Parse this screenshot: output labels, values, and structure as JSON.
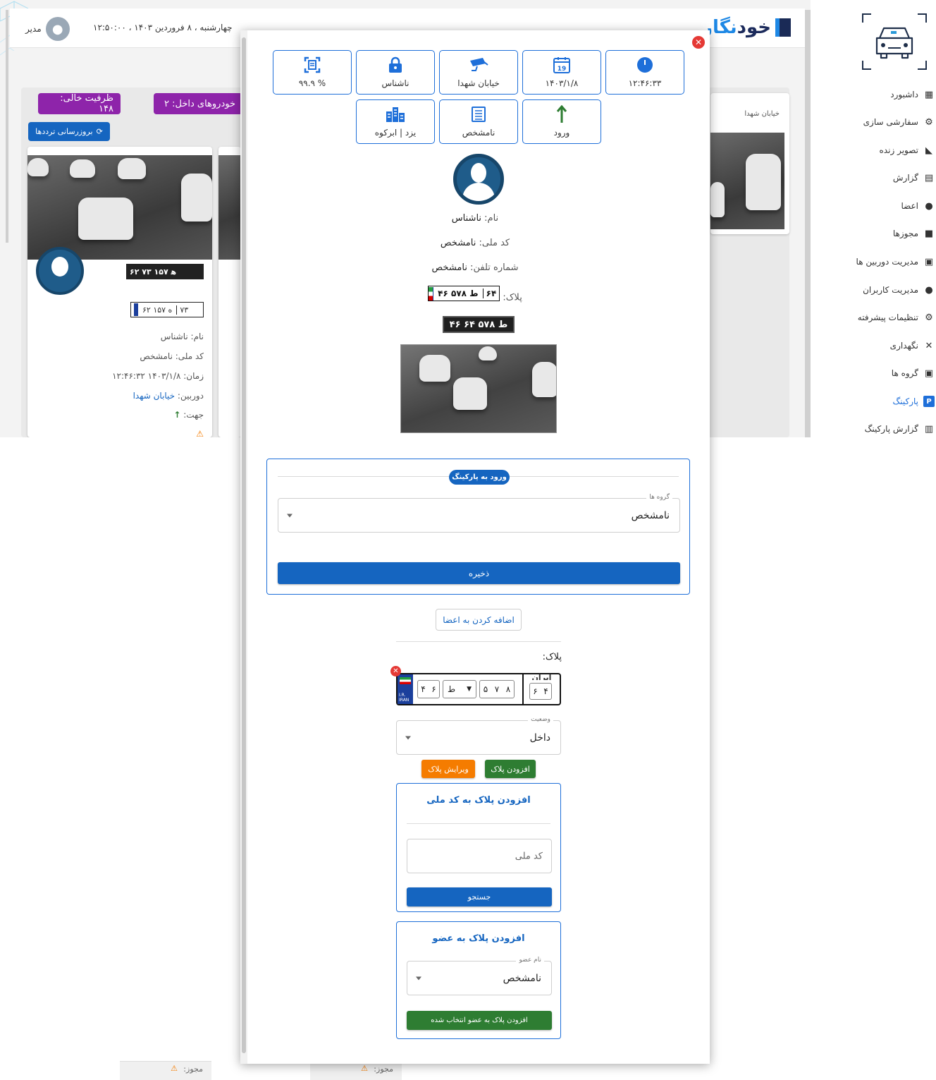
{
  "header": {
    "user_name": "مدیر",
    "datetime": "چهارشنبه ، ۸ فروردین ۱۴۰۳ ، ۱۲:۵۰:۰۰",
    "brand_main": "خود",
    "brand_accent": "نگار"
  },
  "dashboard": {
    "empty_capacity": "ظرفیت خالی:  ۱۴۸",
    "vehicles_inside": "خودروهای داخل:  ۲",
    "refresh_label": "بروزرسانی ترددها",
    "card": {
      "plate_photo": "۶۲ ﻫ ۱۵۷ ۷۳",
      "plate_num": "۶۲ ه ۱۵۷",
      "plate_reg": "۷۳",
      "name": "نام: ناشناس",
      "national_code": "کد ملی: نامشخص",
      "time": "زمان: ۱۴۰۳/۱/۸ ۱۲:۴۶:۳۲",
      "camera_label": "دوربین: ",
      "camera_value": "خیابان شهدا",
      "direction_label": "جهت:",
      "permit_label": "مجوز:"
    },
    "right_card_title": "خیابان شهدا"
  },
  "sidebar": {
    "items": [
      {
        "label": "داشبورد",
        "icon": "dashboard-icon"
      },
      {
        "label": "سفارشی سازی",
        "icon": "gear-icon"
      },
      {
        "label": "تصویر زنده",
        "icon": "camera-icon"
      },
      {
        "label": "گزارش",
        "icon": "report-icon"
      },
      {
        "label": "اعضا",
        "icon": "members-icon"
      },
      {
        "label": "مجوزها",
        "icon": "lock-icon"
      },
      {
        "label": "مدیریت دوربین ها",
        "icon": "camera-manage-icon"
      },
      {
        "label": "مدیریت کاربران",
        "icon": "users-icon"
      },
      {
        "label": "تنظیمات پیشرفته",
        "icon": "advanced-gear-icon"
      },
      {
        "label": "نگهداری",
        "icon": "tools-icon"
      },
      {
        "label": "گروه ها",
        "icon": "groups-icon"
      },
      {
        "label": "پارکینگ",
        "icon": "parking-icon"
      },
      {
        "label": "گزارش پارکینگ",
        "icon": "parking-report-icon"
      }
    ],
    "active": "پارکینگ"
  },
  "modal": {
    "info_row1": [
      {
        "label": "۱۲:۴۶:۳۳",
        "icon": "clock-icon"
      },
      {
        "label": "۱۴۰۳/۱/۸",
        "icon": "calendar-icon",
        "icon_text": "19"
      },
      {
        "label": "خیابان شهدا",
        "icon": "cctv-icon"
      },
      {
        "label": "ناشناس",
        "icon": "lock-icon"
      },
      {
        "label": "% ۹۹.۹",
        "icon": "scan-icon"
      }
    ],
    "info_row2": [
      {
        "label": "ورود",
        "icon": "arrow-up-icon"
      },
      {
        "label": "نامشخص",
        "icon": "list-icon"
      },
      {
        "label": "یزد | ابرکوه",
        "icon": "city-icon"
      }
    ],
    "name_label": "نام:",
    "name_value": "ناشناس",
    "national_label": "کد ملی:",
    "national_value": "نامشخص",
    "phone_label": "شماره تلفن:",
    "phone_value": "نامشخص",
    "plate_label": "پلاک:",
    "plate_num": "۴۶ ط ۵۷۸",
    "plate_reg": "۶۴",
    "plate_photo_text": "۴۶ ط ۵۷۸ ۶۴",
    "parking_entry": {
      "badge": "ورود به پارکینگ",
      "groups_legend": "گروه ها",
      "groups_value": "نامشخص",
      "save_label": "ذخیره"
    },
    "add_member_label": "اضافه کردن به اعضا",
    "plate_editor": {
      "label": "پلاک:",
      "d1": "۴",
      "d2": "۶",
      "letter": "ط",
      "d3": "۵",
      "d4": "۷",
      "d5": "۸",
      "r1": "۶",
      "r2": "۴",
      "iran": "ایران",
      "ir": "I.R.",
      "iran_en": "IRAN"
    },
    "status_legend": "وضعیت",
    "status_value": "داخل",
    "add_plate_label": "افزودن پلاک",
    "edit_plate_label": "ویرایش پلاک",
    "by_national": {
      "title": "افزودن پلاک به کد ملی",
      "placeholder": "کد ملی",
      "search_label": "جستجو"
    },
    "by_member": {
      "title": "افزودن پلاک به عضو",
      "legend": "نام عضو",
      "value": "نامشخص",
      "submit_label": "افزودن پلاک به عضو انتخاب شده"
    }
  },
  "colors": {
    "primary": "#1565c0",
    "accent_blue": "#1e6fd9",
    "purple": "#8e24aa",
    "green": "#2e7d32",
    "orange": "#f57c00",
    "danger": "#e53935"
  }
}
